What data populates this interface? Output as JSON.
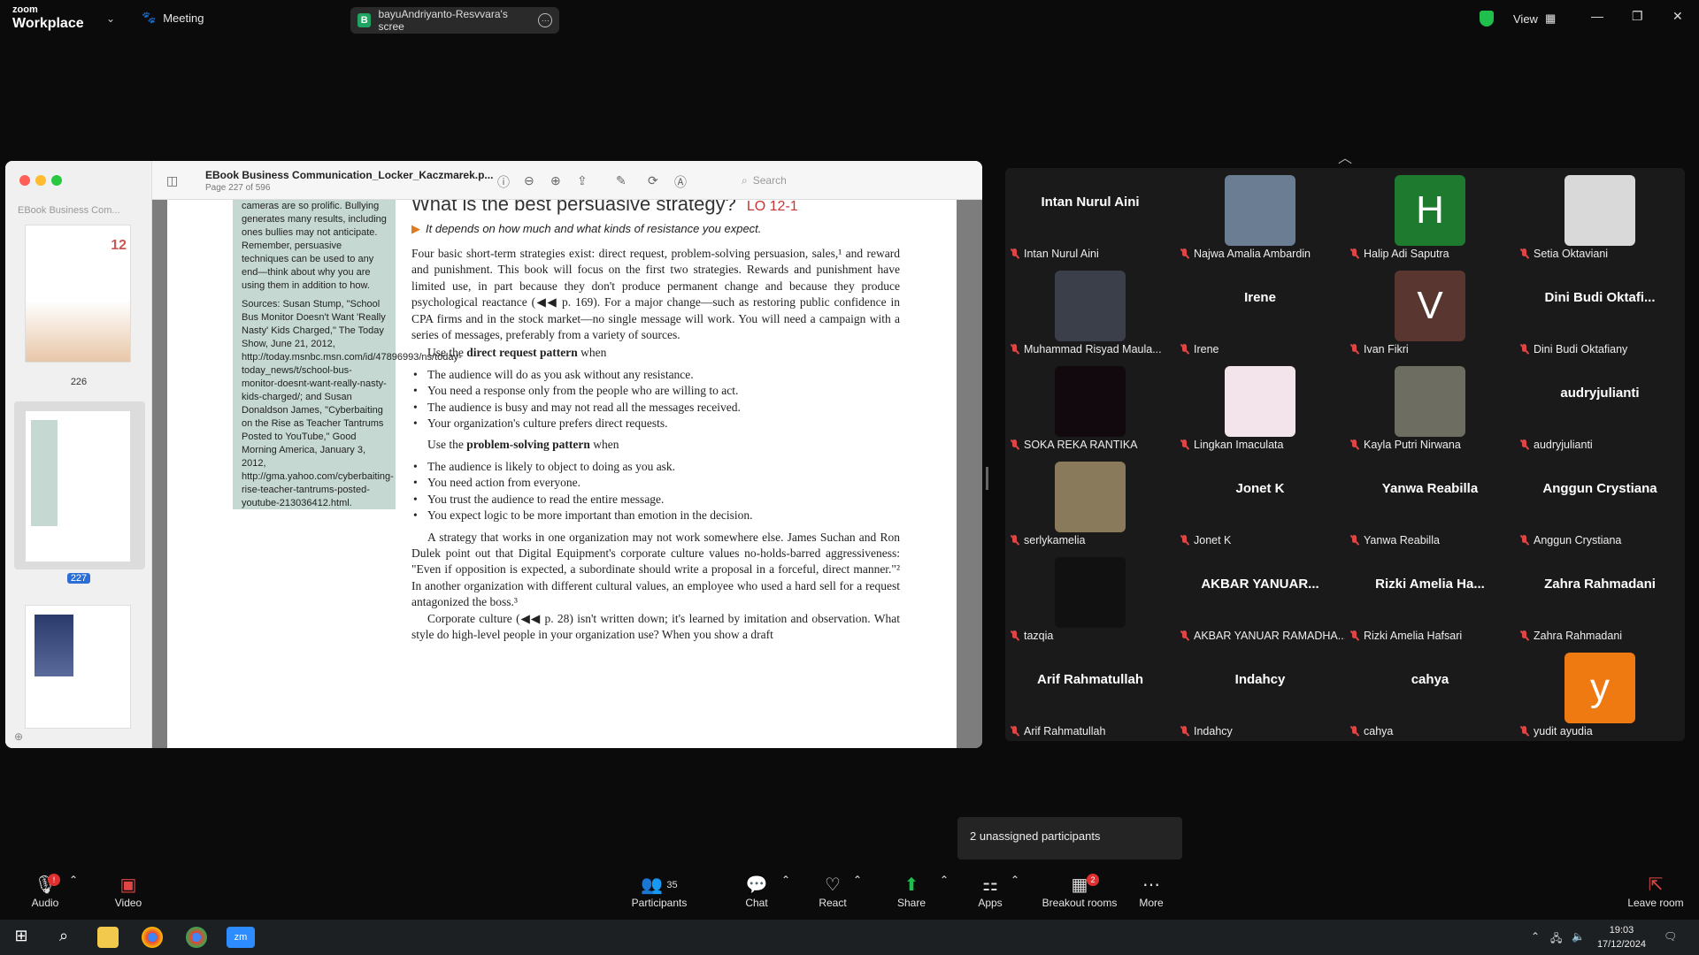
{
  "titlebar": {
    "brand_top": "zoom",
    "brand_bottom": "Workplace",
    "meeting_label": "Meeting",
    "share_name": "bayuAndriyanto-Resvvara's scree",
    "share_badge": "B",
    "view_label": "View"
  },
  "pdf": {
    "sidebar_title": "EBook Business Com...",
    "doc_title": "EBook Business Communication_Locker_Kaczmarek.p...",
    "doc_subtitle": "Page 227 of 596",
    "search_placeholder": "Search",
    "thumbs": [
      {
        "label": "226",
        "chip": "12"
      },
      {
        "label": "227"
      },
      {
        "label": ""
      }
    ],
    "heading": "What is the best persuasive strategy?",
    "heading_lo": "LO 12-1",
    "subhead": "It depends on how much and what kinds of resistance you expect.",
    "sidebox_p1": "cameras are so prolific. Bullying generates many results, including ones bullies may not anticipate. Remember, persuasive techniques can be used to any end—think about why you are using them in addition to how.",
    "sidebox_p2": "Sources: Susan Stump, \"School Bus Monitor Doesn't Want 'Really Nasty' Kids Charged,\" The Today Show, June 21, 2012, http://today.msnbc.msn.com/id/47896993/ns/today-today_news/t/school-bus-monitor-doesnt-want-really-nasty-kids-charged/; and Susan Donaldson James, \"Cyberbaiting on the Rise as Teacher Tantrums Posted to YouTube,\" Good Morning America, January 3, 2012, http://gma.yahoo.com/cyberbaiting-rise-teacher-tantrums-posted-youtube-213036412.html.",
    "para1": "Four basic short-term strategies exist: direct request, problem-solving persuasion, sales,¹ and reward and punishment. This book will focus on the first two strategies. Rewards and punishment have limited use, in part because they don't produce permanent change and because they produce psychological reactance (◀◀ p. 169). For a major change—such as restoring public confidence in CPA firms and in the stock market—no single message will work. You will need a campaign with a series of messages, preferably from a variety of sources.",
    "use1_pre": "Use the ",
    "use1_bold": "direct request pattern",
    "use1_post": " when",
    "list1": [
      "The audience will do as you ask without any resistance.",
      "You need a response only from the people who are willing to act.",
      "The audience is busy and may not read all the messages received.",
      "Your organization's culture prefers direct requests."
    ],
    "use2_pre": "Use the ",
    "use2_bold": "problem-solving pattern",
    "use2_post": " when",
    "list2": [
      "The audience is likely to object to doing as you ask.",
      "You need action from everyone.",
      "You trust the audience to read the entire message.",
      "You expect logic to be more important than emotion in the decision."
    ],
    "para2": "A strategy that works in one organization may not work somewhere else. James Suchan and Ron Dulek point out that Digital Equipment's corporate culture values no-holds-barred aggressiveness: \"Even if opposition is expected, a subordinate should write a proposal in a forceful, direct manner.\"² In another organization with different cultural values, an employee who used a hard sell for a request antagonized the boss.³",
    "para3": "Corporate culture (◀◀ p. 28) isn't written down; it's learned by imitation and observation. What style do high-level people in your organization use? When you show a draft"
  },
  "participants": [
    {
      "center": "Intan Nurul Aini",
      "name": "Intan Nurul Aini",
      "avatar": "",
      "color": ""
    },
    {
      "center": "",
      "name": "Najwa Amalia Ambardin",
      "avatar": "photo",
      "color": "#6b7d92"
    },
    {
      "center": "",
      "name": "Halip Adi Saputra",
      "avatar": "H",
      "color": "#1e7a2e"
    },
    {
      "center": "",
      "name": "Setia Oktaviani",
      "avatar": "photo",
      "color": "#d9d9d9"
    },
    {
      "center": "",
      "name": "Muhammad Risyad Maula...",
      "avatar": "photo",
      "color": "#3a3f4a"
    },
    {
      "center": "Irene",
      "name": "Irene",
      "avatar": "",
      "color": ""
    },
    {
      "center": "",
      "name": "Ivan Fikri",
      "avatar": "V",
      "color": "#5a3630"
    },
    {
      "center": "Dini Budi Oktafi...",
      "name": "Dini Budi Oktafiany",
      "avatar": "",
      "color": ""
    },
    {
      "center": "",
      "name": "SOKA REKA RANTIKA",
      "avatar": "photo",
      "color": "#12090e"
    },
    {
      "center": "",
      "name": "Lingkan Imaculata",
      "avatar": "photo",
      "color": "#f2e4ea"
    },
    {
      "center": "",
      "name": "Kayla Putri Nirwana",
      "avatar": "photo",
      "color": "#6e6d62"
    },
    {
      "center": "audryjulianti",
      "name": "audryjulianti",
      "avatar": "",
      "color": ""
    },
    {
      "center": "",
      "name": "serlykamelia",
      "avatar": "photo",
      "color": "#8a7a5c"
    },
    {
      "center": "Jonet K",
      "name": "Jonet K",
      "avatar": "",
      "color": ""
    },
    {
      "center": "Yanwa Reabilla",
      "name": "Yanwa Reabilla",
      "avatar": "",
      "color": ""
    },
    {
      "center": "Anggun Crystiana",
      "name": "Anggun Crystiana",
      "avatar": "",
      "color": ""
    },
    {
      "center": "",
      "name": "tazqia",
      "avatar": "photo",
      "color": "#111111"
    },
    {
      "center": "AKBAR YANUAR...",
      "name": "AKBAR YANUAR RAMADHA...",
      "avatar": "",
      "color": ""
    },
    {
      "center": "Rizki Amelia Ha...",
      "name": "Rizki Amelia Hafsari",
      "avatar": "",
      "color": ""
    },
    {
      "center": "Zahra Rahmadani",
      "name": "Zahra Rahmadani",
      "avatar": "",
      "color": ""
    },
    {
      "center": "Arif Rahmatullah",
      "name": "Arif Rahmatullah",
      "avatar": "",
      "color": ""
    },
    {
      "center": "Indahcy",
      "name": "Indahcy",
      "avatar": "",
      "color": ""
    },
    {
      "center": "cahya",
      "name": "cahya",
      "avatar": "",
      "color": ""
    },
    {
      "center": "",
      "name": "yudit ayudia",
      "avatar": "y",
      "color": "#f07a12"
    }
  ],
  "popup": {
    "text": "2 unassigned participants"
  },
  "toolbar": {
    "audio": "Audio",
    "video": "Video",
    "participants": "Participants",
    "participants_count": "35",
    "chat": "Chat",
    "react": "React",
    "share": "Share",
    "apps": "Apps",
    "breakout": "Breakout rooms",
    "breakout_badge": "2",
    "more": "More",
    "leave": "Leave room"
  },
  "taskbar": {
    "time": "19:03",
    "date": "17/12/2024"
  },
  "colors": {
    "accent_green": "#1fbf4d",
    "muted_red": "#e04545",
    "sidebox_bg": "#c6d8d2"
  }
}
